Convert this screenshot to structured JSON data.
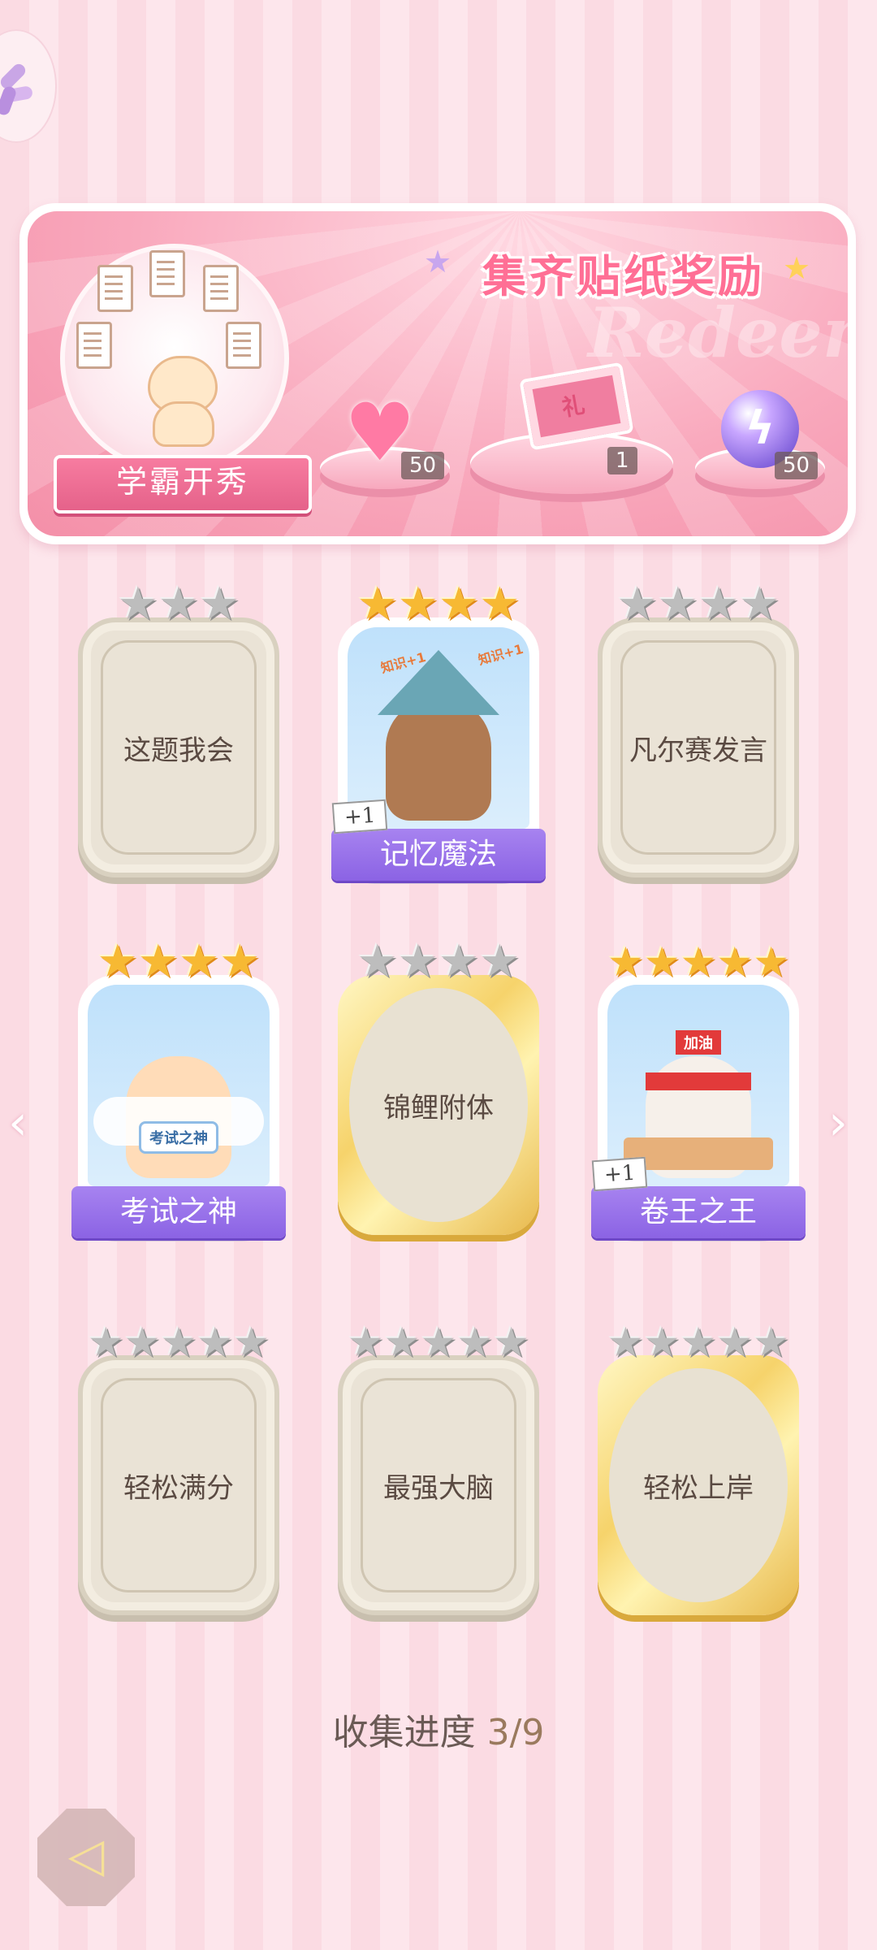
{
  "banner": {
    "title": "集齐贴纸奖励",
    "watermark": "Redeem",
    "ribbon_label": "学霸开秀",
    "rewards": [
      {
        "icon": "heart-gem-icon",
        "count": "50"
      },
      {
        "icon": "gift-box-icon",
        "count": "1",
        "box_text": "礼"
      },
      {
        "icon": "lightning-orb-icon",
        "count": "50"
      }
    ]
  },
  "cards": [
    {
      "label": "这题我会",
      "stars": "★★★",
      "collected": false
    },
    {
      "label": "记忆魔法",
      "stars": "★★★★",
      "collected": true,
      "extra": "+1",
      "art_text": [
        "知识+1",
        "知识+1"
      ]
    },
    {
      "label": "凡尔赛发言",
      "stars": "★★★★",
      "collected": false
    },
    {
      "label": "考试之神",
      "stars": "★★★★",
      "collected": true,
      "sign": "考试之神"
    },
    {
      "label": "锦鲤附体",
      "stars": "★★★★",
      "collected": false
    },
    {
      "label": "卷王之王",
      "stars": "★★★★★",
      "collected": true,
      "extra": "+1",
      "headband": "加油"
    },
    {
      "label": "轻松满分",
      "stars": "★★★★★",
      "collected": false
    },
    {
      "label": "最强大脑",
      "stars": "★★★★★",
      "collected": false
    },
    {
      "label": "轻松上岸",
      "stars": "★★★★★",
      "collected": false
    }
  ],
  "progress": {
    "label": "收集进度",
    "value": "3/9"
  },
  "nav": {
    "left_arrow": "‹",
    "right_arrow": "›",
    "back_glyph": "◁"
  },
  "colors": {
    "accent_pink": "#ff6f95",
    "name_banner_purple": "#8b63e4",
    "star_gold": "#f7b933"
  }
}
